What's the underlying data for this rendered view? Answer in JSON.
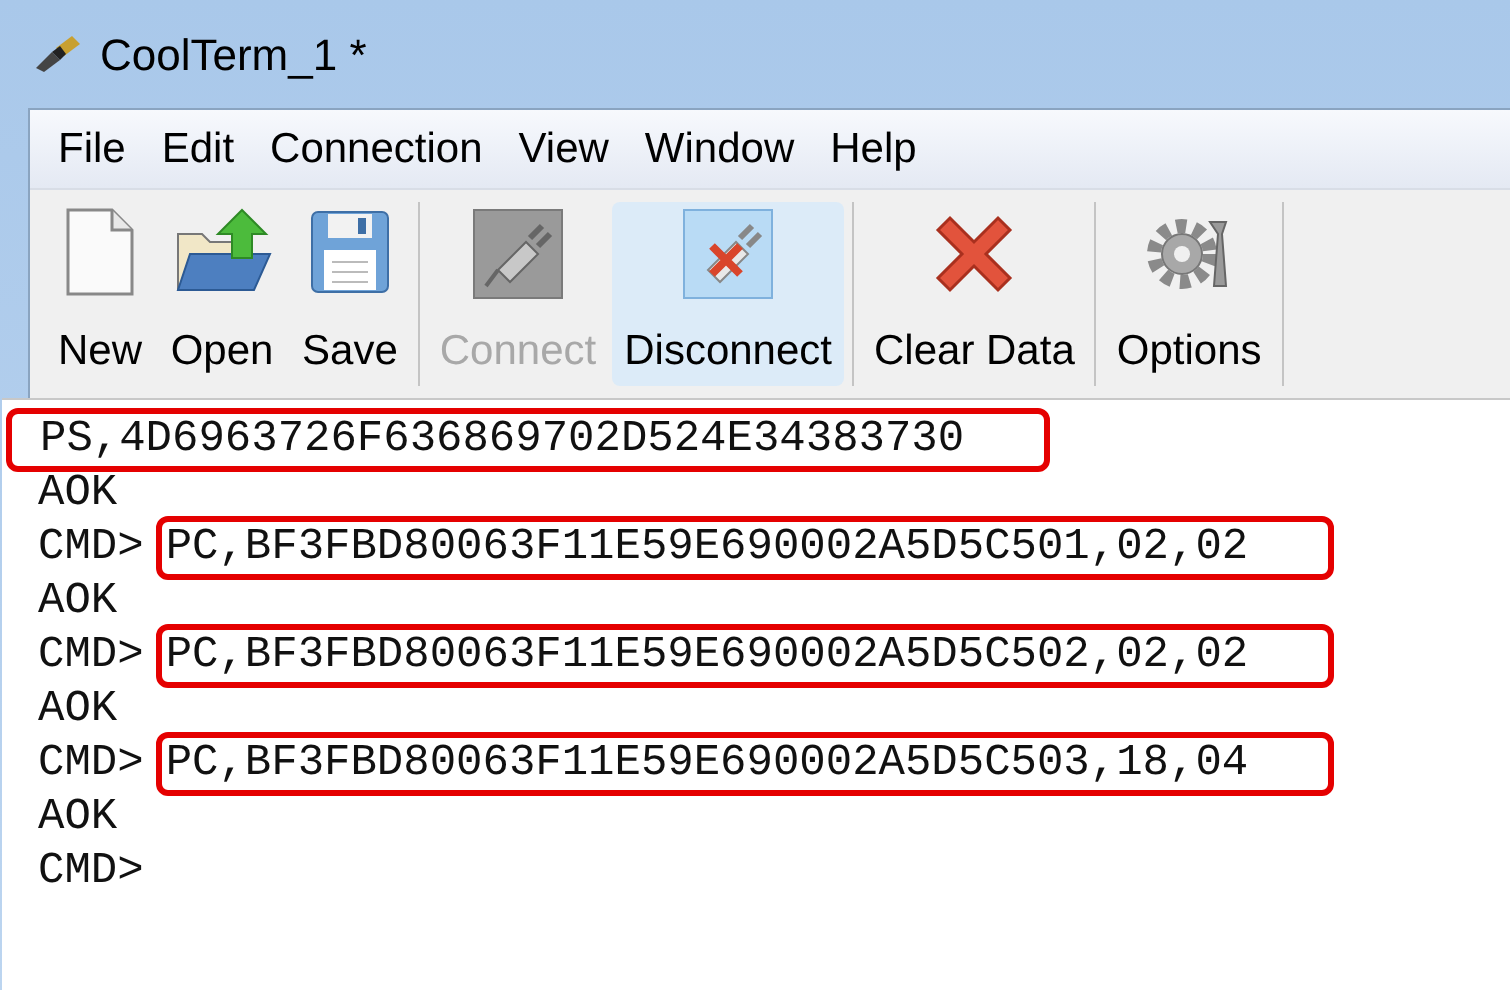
{
  "window": {
    "title": "CoolTerm_1 *"
  },
  "menu": [
    "File",
    "Edit",
    "Connection",
    "View",
    "Window",
    "Help"
  ],
  "toolbar": [
    [
      {
        "kind": "new",
        "label": "New",
        "disabled": false,
        "active": false
      },
      {
        "kind": "open",
        "label": "Open",
        "disabled": false,
        "active": false
      },
      {
        "kind": "save",
        "label": "Save",
        "disabled": false,
        "active": false
      }
    ],
    [
      {
        "kind": "connect",
        "label": "Connect",
        "disabled": true,
        "active": false
      },
      {
        "kind": "disconnect",
        "label": "Disconnect",
        "disabled": false,
        "active": true
      }
    ],
    [
      {
        "kind": "clear",
        "label": "Clear Data",
        "disabled": false,
        "active": false
      }
    ],
    [
      {
        "kind": "options",
        "label": "Options",
        "disabled": false,
        "active": false
      }
    ]
  ],
  "terminal": {
    "lines": [
      {
        "command": "PS,4D6963726F636869702D524E34383730",
        "highlighted": true
      },
      {
        "command": "AOK",
        "highlighted": false
      },
      {
        "prompt": "CMD>",
        "command": "PC,BF3FBD80063F11E59E690002A5D5C501,02,02",
        "highlighted": true
      },
      {
        "command": "AOK",
        "highlighted": false
      },
      {
        "prompt": "CMD>",
        "command": "PC,BF3FBD80063F11E59E690002A5D5C502,02,02",
        "highlighted": true
      },
      {
        "command": "AOK",
        "highlighted": false
      },
      {
        "prompt": "CMD>",
        "command": "PC,BF3FBD80063F11E59E690002A5D5C503,18,04",
        "highlighted": true
      },
      {
        "command": "AOK",
        "highlighted": false
      },
      {
        "prompt": "CMD>",
        "highlighted": false
      }
    ]
  }
}
